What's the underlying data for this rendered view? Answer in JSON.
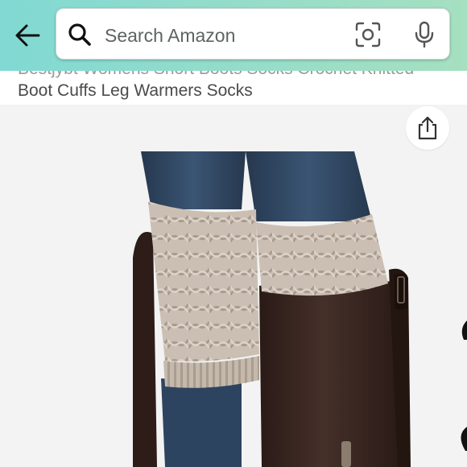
{
  "header": {
    "search": {
      "placeholder": "Search Amazon"
    }
  },
  "product": {
    "title_line1": "Bestjybt Womens Short Boots Socks Crochet Knitted",
    "title_line2": "Boot Cuffs Leg Warmers Socks"
  },
  "icons": {
    "back": "arrow-left-icon",
    "search": "search-icon",
    "camera": "camera-scan-icon",
    "mic": "microphone-icon",
    "share": "share-icon"
  },
  "colors": {
    "header_gradient_start": "#80d9d3",
    "header_gradient_end": "#a5e0c0",
    "boot": "#3a2520",
    "knit": "#cbbfb3",
    "denim": "#2f4560"
  }
}
